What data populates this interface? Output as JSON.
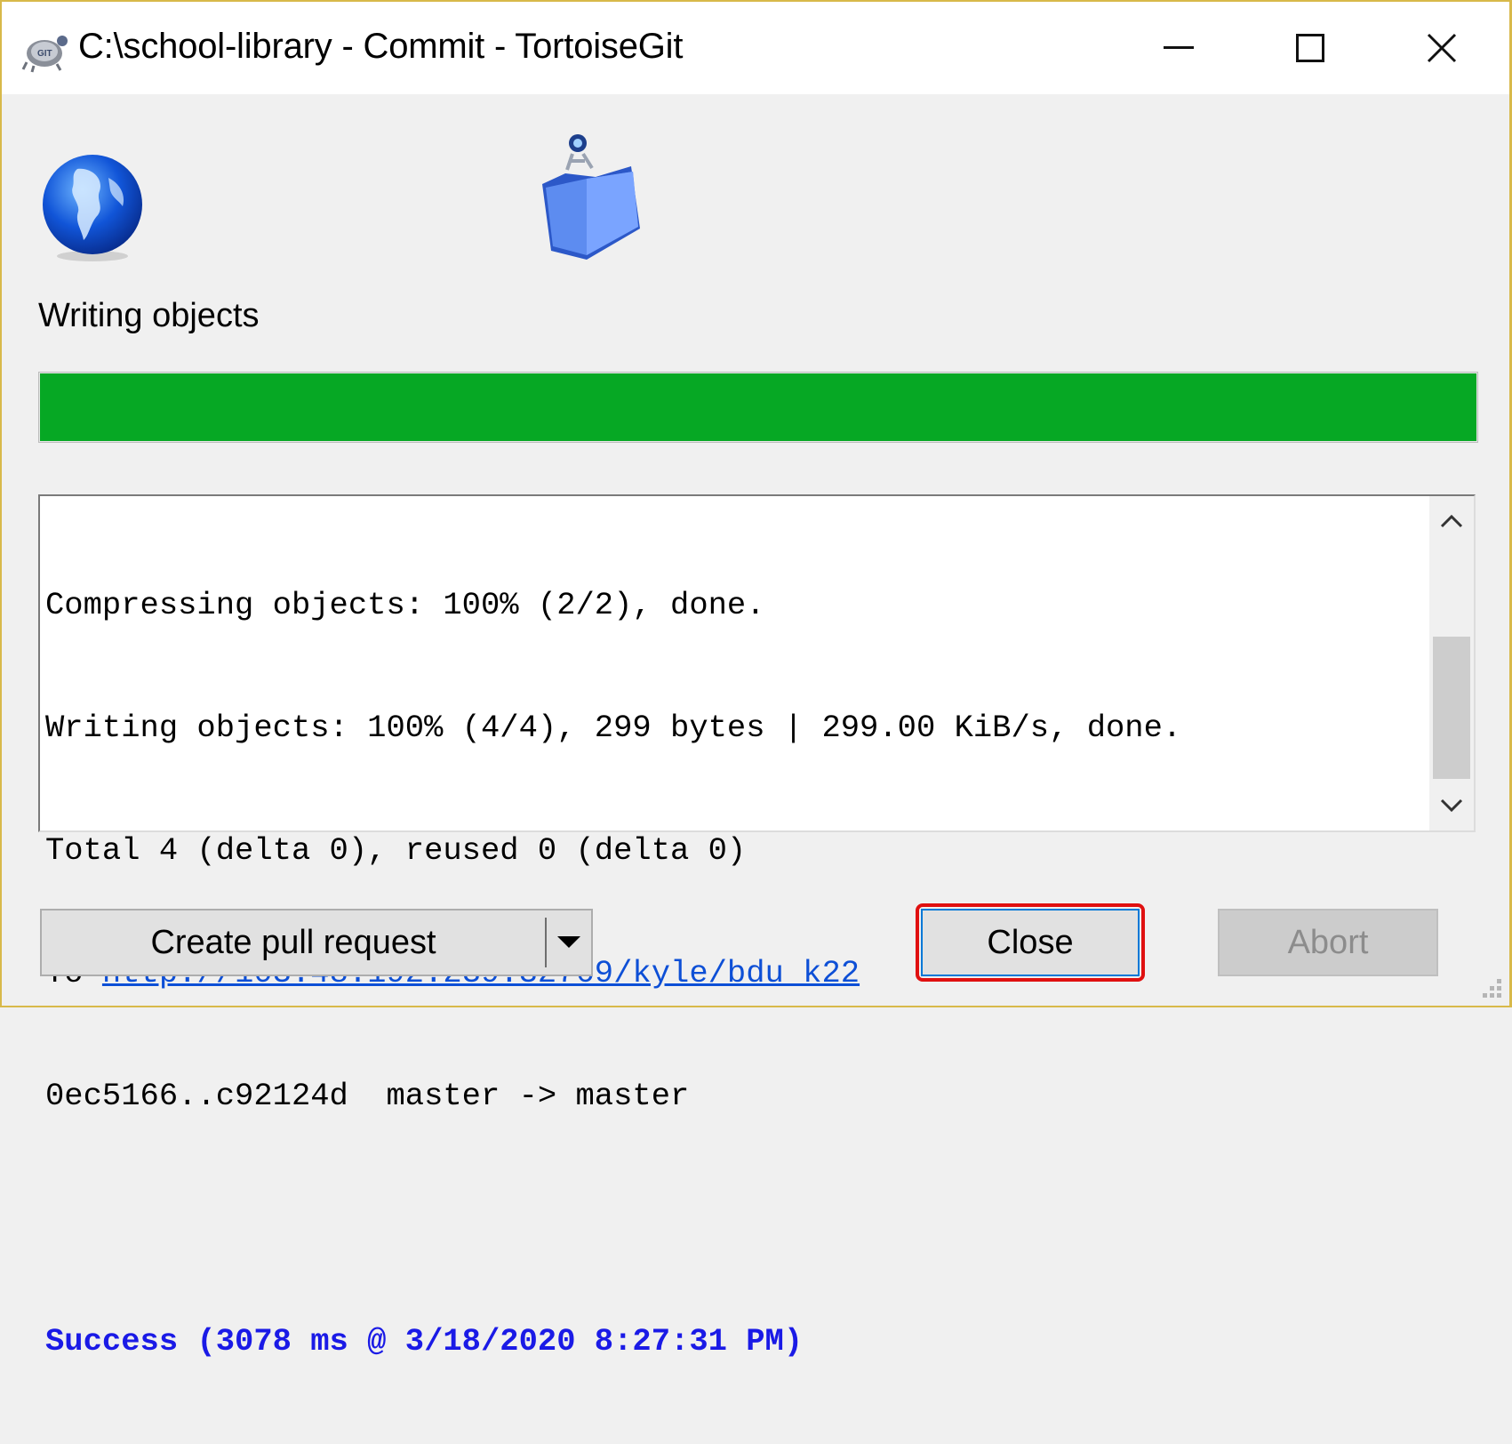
{
  "window": {
    "title": "C:\\school-library - Commit - TortoiseGit"
  },
  "status": {
    "label": "Writing objects",
    "progress_percent": 100,
    "progress_color": "#06a824"
  },
  "log": {
    "line1": "Compressing objects: 100% (2/2), done.",
    "line2": "Writing objects: 100% (4/4), 299 bytes | 299.00 KiB/s, done.",
    "line3": "Total 4 (delta 0), reused 0 (delta 0)",
    "line4_prefix": "To ",
    "line4_url": "http://103.48.192.239:32769/kyle/bdu_k22",
    "line5": "0ec5166..c92124d  master -> master",
    "success": "Success (3078 ms @ 3/18/2020 8:27:31 PM)"
  },
  "buttons": {
    "create_pull_request": "Create pull request",
    "close": "Close",
    "abort": "Abort"
  },
  "colors": {
    "link": "#0d4fd6",
    "success": "#1a1ae6",
    "highlight": "#e01010"
  },
  "icons": {
    "app": "tortoisegit-icon",
    "globe": "globe-icon",
    "folder": "folder-icon",
    "minimize": "minimize-icon",
    "maximize": "maximize-icon",
    "close": "close-icon"
  }
}
